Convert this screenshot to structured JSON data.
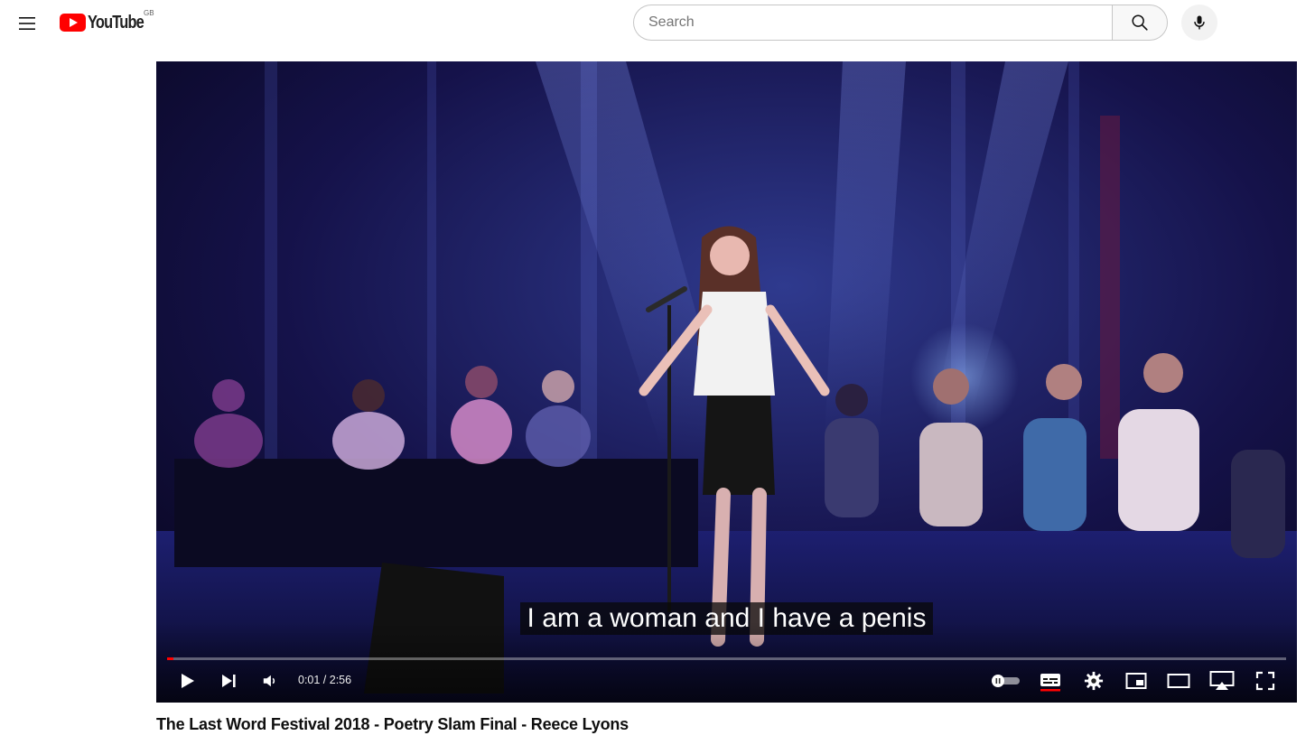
{
  "masthead": {
    "logo_text": "YouTube",
    "country_code": "GB",
    "search": {
      "placeholder": "Search",
      "value": ""
    }
  },
  "player": {
    "caption": "I am a woman and I have a penis",
    "time": {
      "current": "0:01",
      "duration": "2:56",
      "display": "0:01 / 2:56"
    },
    "progress_fraction": 0.006,
    "autoplay_on": false,
    "subtitles_on": true
  },
  "video": {
    "title": "The Last Word Festival 2018 - Poetry Slam Final - Reece Lyons"
  },
  "colors": {
    "brand_red": "#ff0000",
    "progress_red": "#ff0000",
    "stage_blue": "#2a2a8a"
  },
  "icons": {
    "menu": "hamburger-menu-icon",
    "search": "search-icon",
    "mic": "microphone-icon",
    "play": "play-icon",
    "next": "next-icon",
    "volume": "volume-icon",
    "autoplay": "autoplay-toggle-icon",
    "subtitles": "subtitles-icon",
    "settings": "gear-icon",
    "miniplayer": "miniplayer-icon",
    "theater": "theater-mode-icon",
    "airplay": "airplay-icon",
    "fullscreen": "fullscreen-icon"
  }
}
